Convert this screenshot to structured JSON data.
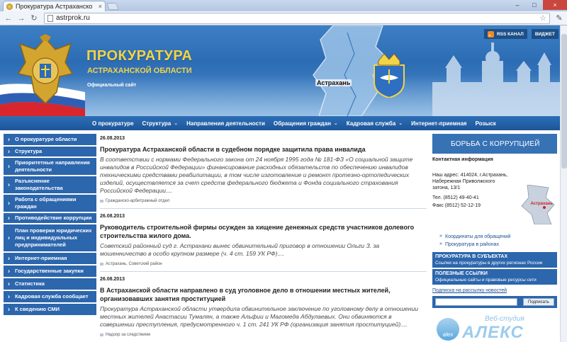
{
  "browser": {
    "tab_title": "Прокуратура Астраханско",
    "tab_close": "×",
    "url": "astrprok.ru",
    "minimize": "–",
    "maximize": "□",
    "close": "×"
  },
  "header": {
    "title": "ПРОКУРАТУРА",
    "subtitle": "АСТРАХАНСКОЙ ОБЛАСТИ",
    "official": "Официальный сайт",
    "city_label": "Астрахань",
    "rss_label": "RSS КАНАЛ",
    "widget_label": "ВИДЖЕТ"
  },
  "topnav": [
    {
      "label": "О прокуратуре",
      "caret": false
    },
    {
      "label": "Структура",
      "caret": true
    },
    {
      "label": "Направления деятельности",
      "caret": false
    },
    {
      "label": "Обращения граждан",
      "caret": true
    },
    {
      "label": "Кадровая служба",
      "caret": true
    },
    {
      "label": "Интернет-приемная",
      "caret": false
    },
    {
      "label": "Розыск",
      "caret": false
    }
  ],
  "sidebar": [
    "О прокуратуре области",
    "Структура",
    "Приоритетные направления деятельности",
    "Разъяснение законодательства",
    "Работа с обращениями граждан",
    "Противодействие коррупции",
    "План проверки юридических лиц и индивидуальных предпринимателей",
    "Интернет-приемная",
    "Государственные закупки",
    "Статистика",
    "Кадровая служба сообщает",
    "К сведению СМИ"
  ],
  "news": [
    {
      "date": "26.08.2013",
      "title": "Прокуратура Астраханской области в судебном порядке защитила права инвалида",
      "body": "В соответствии с нормами Федерального закона от 24 ноября 1995 года № 181-ФЗ «О социальной защите инвалидов в Российской Федерации» финансирование расходных обязательств по обеспечению инвалидов техническими средствами реабилитации, в том числе изготовление и ремонт протезно-ортопедических изделий, осуществляется за счет средств федерального бюджета и Фонда социального страхования Российской Федерации....",
      "source": "Гражданско-арбитражный отдел"
    },
    {
      "date": "26.08.2013",
      "title": "Руководитель строительной фирмы осужден за хищение денежных средств участников долевого строительства жилого дома.",
      "body": "Советский районный суд г. Астрахани вынес обвинительный приговор в отношении Ольги З. за мошенничество в особо крупном размере (ч. 4 ст. 159 УК РФ)....",
      "source": "Астрахань, Советский район"
    },
    {
      "date": "26.08.2013",
      "title": "В Астраханской области направлено в суд уголовное дело в отношении местных жителей, организовавших занятия проституцией",
      "body": "Прокуратура Астраханской области утвердила обвинительное заключение по уголовному делу в отношении местных жителей Анастасии Тумалян, а также Альфии и Магомеда Абдулаевых. Они обвиняются в совершении преступления, предусмотренного ч. 1 ст. 241 УК РФ (организация занятия проституцией)....",
      "source": "Надзор за следствием"
    }
  ],
  "right": {
    "corruption": "БОРЬБА С КОРРУПЦИЕЙ",
    "contact_title": "Контактная информация",
    "address": "Наш адрес: 414024, г.Астрахань, Набережная Приволжского затона, 13/1",
    "phone": "Тел. (8512) 49-40-41",
    "fax": "Факс (8512) 52-12-19",
    "region_label": "Астрахань",
    "link_coords": "Координаты для обращений",
    "link_districts": "Прокуратура в районах",
    "subjects_title": "ПРОКУРАТУРА В СУБЪЕКТАХ",
    "subjects_sub": "Ссылки на прокуратуры в других регионах России",
    "useful_title": "ПОЛЕЗНЫЕ ССЫЛКИ",
    "useful_sub": "Официальные сайты и правовые ресурсы сети",
    "subscribe_link": "Подписка на рассылку новостей",
    "subscribe_btn": "Подписать"
  },
  "watermark": {
    "studio": "Веб-студия",
    "name": "АЛЕКС",
    "alex": "alex"
  },
  "colors": {
    "header_blue": "#2c6cb4",
    "nav_blue": "#1d5599",
    "sidebar_blue": "#2c66ad",
    "title_gold": "#f3d347",
    "link_blue": "#1c4f91"
  }
}
